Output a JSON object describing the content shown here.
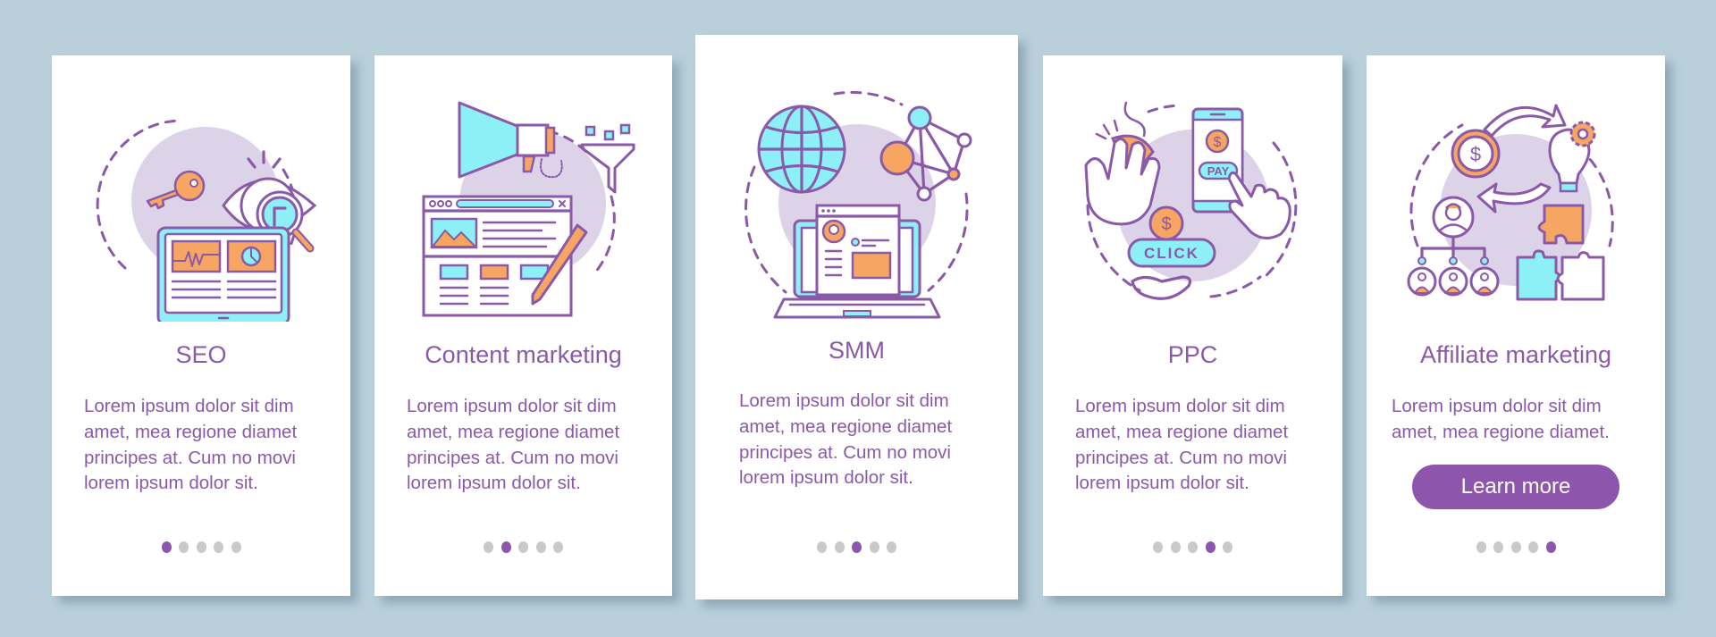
{
  "colors": {
    "background": "#b9d0db",
    "card": "#ffffff",
    "accent_purple": "#8e55ad",
    "text_purple": "#8a5aa8",
    "icon_cyan": "#8df0f7",
    "icon_orange": "#f7a563",
    "blob_lavender": "#ddd3e8",
    "dot_inactive": "#c9c9c9"
  },
  "screens": [
    {
      "title": "SEO",
      "illustration": "seo-illustration (key, eye with magnifier, monitor with charts)",
      "body": "Lorem ipsum dolor sit dim amet, mea regione diamet principes at. Cum no movi lorem ipsum dolor sit.",
      "page_index": 1,
      "page_count": 5
    },
    {
      "title": "Content marketing",
      "illustration": "content-marketing-illustration (megaphone, funnel, web page, pencil)",
      "body": "Lorem ipsum dolor sit dim amet, mea regione diamet principes at. Cum no movi lorem ipsum dolor sit.",
      "page_index": 2,
      "page_count": 5
    },
    {
      "title": "SMM",
      "illustration": "smm-illustration (globe, network nodes, laptop with profile)",
      "body": "Lorem ipsum dolor sit dim amet, mea regione diamet principes at. Cum no movi lorem ipsum dolor sit.",
      "page_index": 3,
      "page_count": 5
    },
    {
      "title": "PPC",
      "illustration": "ppc-illustration (hand on mouse, phone PAY, CLICK button, coin)",
      "body": "Lorem ipsum dolor sit dim amet, mea regione diamet principes at. Cum no movi lorem ipsum dolor sit.",
      "page_index": 4,
      "page_count": 5,
      "labels": {
        "pay": "PAY",
        "click": "CLICK",
        "currency": "$"
      }
    },
    {
      "title": "Affiliate marketing",
      "illustration": "affiliate-illustration (coin, lightbulb with gear, people hierarchy, puzzle)",
      "body": "Lorem ipsum dolor sit dim amet, mea regione diamet.",
      "button_label": "Learn more",
      "page_index": 5,
      "page_count": 5,
      "labels": {
        "currency": "$"
      }
    }
  ]
}
